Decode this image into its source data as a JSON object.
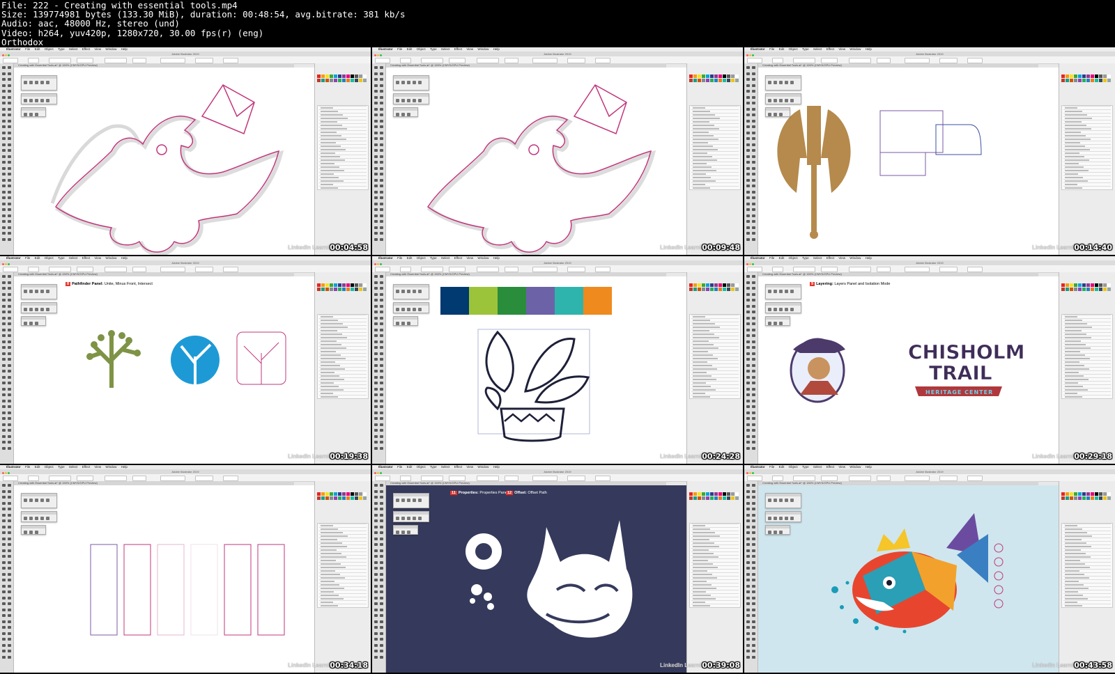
{
  "header": {
    "lines": [
      "File: 222 - Creating with essential tools.mp4",
      "Size: 139774981 bytes (133.30 MiB), duration: 00:48:54, avg.bitrate: 381 kb/s",
      "Audio: aac, 48000 Hz, stereo (und)",
      "Video: h264, yuv420p, 1280x720, 30.00 fps(r) (eng)",
      "Orthodox"
    ]
  },
  "app": {
    "menu": [
      "Illustrator",
      "File",
      "Edit",
      "Object",
      "Type",
      "Select",
      "Effect",
      "View",
      "Window",
      "Help"
    ],
    "window_title": "Adobe Illustrator 2019",
    "doc_tab": "Creating with Essential Tools.ai* @ 150% (CMYK/GPU Preview)",
    "watermark": "LinkedIn Learning"
  },
  "colors": {
    "magenta": "#c2367d",
    "navy": "#1d2038",
    "lynx_bg": "#353a5c",
    "axe": "#b58a4c",
    "tree_green": "#7e9346",
    "tree_blue": "#1d9ad6",
    "fish_bg": "#cfe6ee",
    "badge_red": "#e8342a"
  },
  "palette_strip": [
    "#003a70",
    "#9cc43a",
    "#2a8d3c",
    "#6b62a8",
    "#2fb4ad",
    "#ef8a1e"
  ],
  "tiles": [
    {
      "timestamp": "00:04:58",
      "scene": "bird-outline"
    },
    {
      "timestamp": "00:09:48",
      "scene": "bird-outline-2"
    },
    {
      "timestamp": "00:14:40",
      "scene": "axe-and-shapes"
    },
    {
      "timestamp": "00:19:38",
      "scene": "pathfinder-trees",
      "caption_num": "8",
      "caption_bold": "Pathfinder Panel:",
      "caption_rest": " Unite, Minus Front, Intersect"
    },
    {
      "timestamp": "00:24:28",
      "scene": "plant-pot"
    },
    {
      "timestamp": "00:29:18",
      "scene": "chisholm-logo",
      "caption_num": "9",
      "caption_bold": "Layering:",
      "caption_rest": " Layers Panel and Isolation Mode",
      "logo_line1": "CHISHOLM",
      "logo_line2": "TRAIL",
      "logo_ribbon": "HERITAGE CENTER"
    },
    {
      "timestamp": "00:34:18",
      "scene": "rectangles"
    },
    {
      "timestamp": "00:39:08",
      "scene": "lynx",
      "caption_num": "11",
      "caption_bold": "Properties:",
      "caption_rest": " Properties Panel",
      "caption2_num": "12",
      "caption2_bold": "Offset:",
      "caption2_rest": " Offset Path"
    },
    {
      "timestamp": "00:43:58",
      "scene": "fish"
    }
  ]
}
